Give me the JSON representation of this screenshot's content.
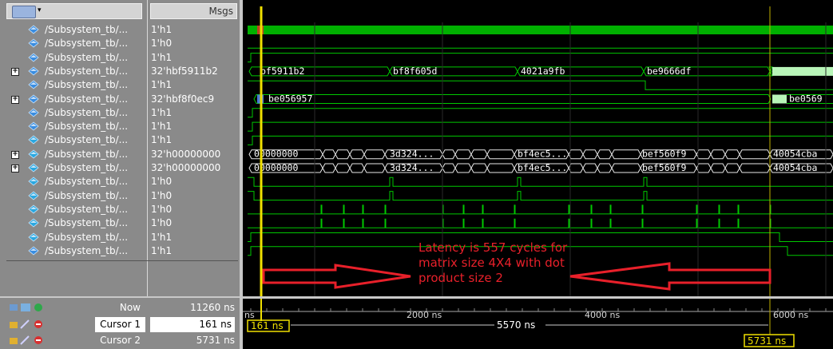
{
  "toolbar": {
    "values_header": "Msgs"
  },
  "signals": [
    {
      "name": "/Subsystem_tb/...",
      "value": "1'h1",
      "expandable": false,
      "icon": "signal-diamond-icon"
    },
    {
      "name": "/Subsystem_tb/...",
      "value": "1'h0",
      "expandable": false,
      "icon": "signal-diamond-icon"
    },
    {
      "name": "/Subsystem_tb/...",
      "value": "1'h1",
      "expandable": false,
      "icon": "signal-diamond-icon"
    },
    {
      "name": "/Subsystem_tb/...",
      "value": "32'hbf5911b2",
      "expandable": true,
      "icon": "signal-diamond-icon"
    },
    {
      "name": "/Subsystem_tb/...",
      "value": "1'h1",
      "expandable": false,
      "icon": "signal-diamond-icon"
    },
    {
      "name": "/Subsystem_tb/...",
      "value": "32'hbf8f0ec9",
      "expandable": true,
      "icon": "signal-diamond-icon"
    },
    {
      "name": "/Subsystem_tb/...",
      "value": "1'h1",
      "expandable": false,
      "icon": "signal-diamond-icon"
    },
    {
      "name": "/Subsystem_tb/...",
      "value": "1'h1",
      "expandable": false,
      "icon": "signal-diamond-icon"
    },
    {
      "name": "/Subsystem_tb/...",
      "value": "1'h1",
      "expandable": false,
      "icon": "signal-diamond-output-icon"
    },
    {
      "name": "/Subsystem_tb/...",
      "value": "32'h00000000",
      "expandable": true,
      "icon": "signal-diamond-output-icon"
    },
    {
      "name": "/Subsystem_tb/...",
      "value": "32'h00000000",
      "expandable": true,
      "icon": "signal-diamond-output-icon"
    },
    {
      "name": "/Subsystem_tb/...",
      "value": "1'h0",
      "expandable": false,
      "icon": "signal-diamond-output-icon"
    },
    {
      "name": "/Subsystem_tb/...",
      "value": "1'h0",
      "expandable": false,
      "icon": "signal-diamond-output-icon"
    },
    {
      "name": "/Subsystem_tb/...",
      "value": "1'h0",
      "expandable": false,
      "icon": "signal-diamond-output-icon"
    },
    {
      "name": "/Subsystem_tb/...",
      "value": "1'h0",
      "expandable": false,
      "icon": "signal-diamond-output-icon"
    },
    {
      "name": "/Subsystem_tb/...",
      "value": "1'h1",
      "expandable": false,
      "icon": "signal-diamond-output-icon"
    },
    {
      "name": "/Subsystem_tb/...",
      "value": "1'h1",
      "expandable": false,
      "icon": "signal-diamond-icon"
    }
  ],
  "bus_labels": {
    "row3": [
      "bf5911b2",
      "bf8f605d",
      "4021a9fb",
      "be9666df"
    ],
    "row5": [
      "be056957",
      "be0569"
    ],
    "row9": [
      "00000000",
      "3d324...",
      "bf4ec5...",
      "bef560f9",
      "40054cba"
    ],
    "row10": [
      "00000000",
      "3d324...",
      "bf4ec5...",
      "bef560f9",
      "40054cba"
    ]
  },
  "bottom": {
    "now_label": "Now",
    "now_value": "11260 ns",
    "cursor1_label": "Cursor 1",
    "cursor1_value": "161 ns",
    "cursor2_label": "Cursor 2",
    "cursor2_value": "5731 ns"
  },
  "timeline": {
    "ticks": [
      "ns",
      "2000 ns",
      "4000 ns",
      "6000 ns"
    ],
    "cursor1_tag": "161 ns",
    "cursor2_tag": "5731 ns",
    "delta": "5570 ns"
  },
  "annotation": {
    "lines": [
      "Latency is 557 cycles for",
      "matrix size 4X4 with dot",
      "product size 2"
    ]
  },
  "colors": {
    "wave_green": "#00c800",
    "bus_fill": "#b8f5b8",
    "cursor_yellow": "#f0e000",
    "annotation_red": "#e8202a"
  }
}
